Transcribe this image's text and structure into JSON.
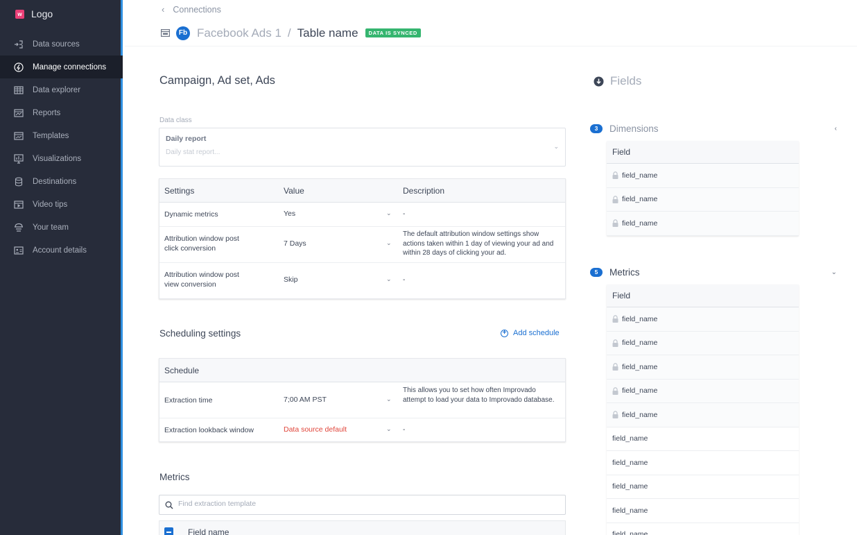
{
  "sidebar": {
    "logo_letter": "w",
    "logo_text": "Logo",
    "items": [
      {
        "label": "Data sources",
        "icon": "data-sources-icon"
      },
      {
        "label": "Manage connections",
        "icon": "connections-icon",
        "active": true
      },
      {
        "label": "Data explorer",
        "icon": "table-grid-icon"
      },
      {
        "label": "Reports",
        "icon": "reports-icon"
      },
      {
        "label": "Templates",
        "icon": "templates-icon"
      },
      {
        "label": "Visualizations",
        "icon": "visualizations-icon"
      },
      {
        "label": "Destinations",
        "icon": "database-icon"
      },
      {
        "label": "Video tips",
        "icon": "video-icon"
      },
      {
        "label": "Your team",
        "icon": "team-icon"
      },
      {
        "label": "Account details",
        "icon": "id-card-icon"
      }
    ]
  },
  "header": {
    "breadcrumb": "Connections",
    "source_badge": "Fb",
    "source_name": "Facebook Ads 1",
    "separator": "/",
    "table_name": "Table name",
    "status_badge": "DATA IS SYNCED"
  },
  "main": {
    "title": "Campaign, Ad set, Ads",
    "data_class": {
      "label": "Data class",
      "value": "Daily report",
      "placeholder": "Daily stat report..."
    },
    "settings_table": {
      "headers": [
        "Settings",
        "Value",
        "Description"
      ],
      "rows": [
        {
          "setting": "Dynamic metrics",
          "value": "Yes",
          "description": "-"
        },
        {
          "setting": "Attribution window post click conversion",
          "value": "7 Days",
          "description": "The default attribution window settings show actions taken within 1 day of viewing your ad and within 28 days of clicking your ad."
        },
        {
          "setting": "Attribution window post view conversion",
          "value": "Skip",
          "description": "-"
        }
      ]
    },
    "scheduling": {
      "title": "Scheduling settings",
      "add_label": "Add schedule",
      "header": "Schedule",
      "rows": [
        {
          "setting": "Extraction time",
          "value": "7;00 AM PST",
          "description": "This allows you to set how often Improvado attempt to load your data to Improvado database."
        },
        {
          "setting": "Extraction lookback window",
          "value": "Data source default",
          "description": "-"
        }
      ]
    },
    "metrics": {
      "title": "Metrics",
      "search_placeholder": "Find extraction template",
      "column_header": "Field name"
    }
  },
  "fields": {
    "title": "Fields",
    "dimensions": {
      "count": "3",
      "title": "Dimensions",
      "header": "Field",
      "rows": [
        "field_name",
        "field_name",
        "field_name"
      ]
    },
    "metrics": {
      "count": "5",
      "title": "Metrics",
      "header": "Field",
      "locked_rows": [
        "field_name",
        "field_name",
        "field_name",
        "field_name",
        "field_name"
      ],
      "rows": [
        "field_name",
        "field_name",
        "field_name",
        "field_name",
        "field_name"
      ]
    }
  },
  "colors": {
    "sidebar_bg": "#272c3a",
    "accent_blue": "#1a6fd1",
    "synced_green": "#35b56f",
    "error_red": "#e0453a",
    "brand_pink": "#ea3f77"
  }
}
